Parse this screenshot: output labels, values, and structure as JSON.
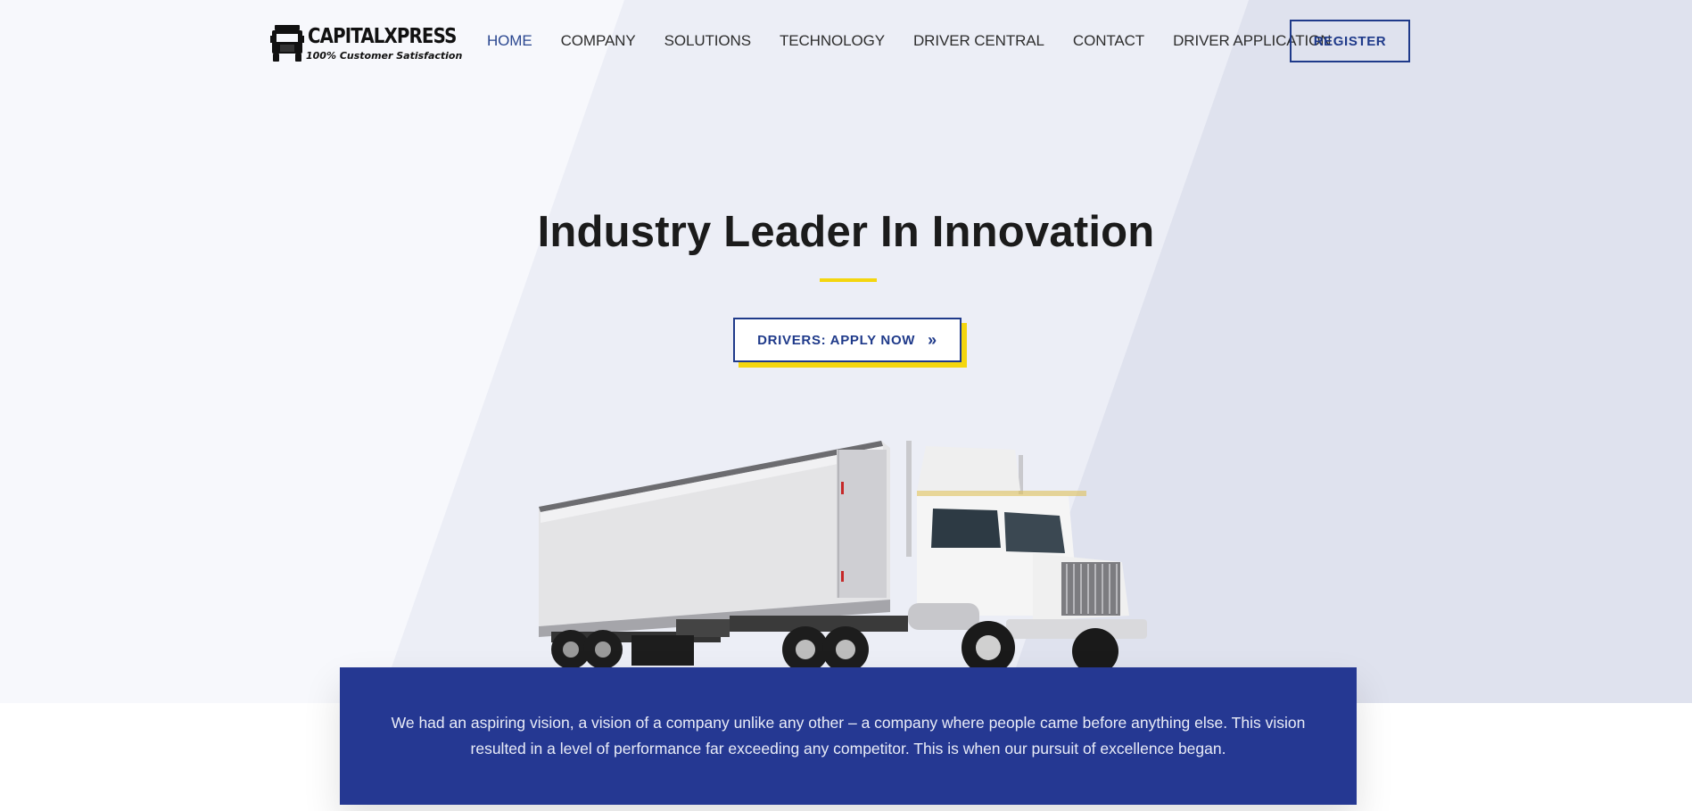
{
  "brand": {
    "name": "CAPITALXPRESS",
    "tagline": "100% Customer Satisfaction"
  },
  "nav": {
    "items": [
      {
        "label": "HOME",
        "active": true
      },
      {
        "label": "COMPANY",
        "active": false
      },
      {
        "label": "SOLUTIONS",
        "active": false
      },
      {
        "label": "TECHNOLOGY",
        "active": false
      },
      {
        "label": "DRIVER CENTRAL",
        "active": false
      },
      {
        "label": "CONTACT",
        "active": false
      },
      {
        "label": "DRIVER APPLICATION",
        "active": false
      }
    ],
    "register_label": "REGISTER"
  },
  "hero": {
    "headline": "Industry Leader In Innovation",
    "cta_label": "DRIVERS: APPLY NOW",
    "cta_icon": "double-chevron-right-icon"
  },
  "vision": {
    "text": "We had an aspiring vision, a vision of a company unlike any other – a company where people came before anything else. This vision resulted in a level of performance far exceeding any competitor. This is when our pursuit of excellence began."
  },
  "colors": {
    "primary": "#253892",
    "accent": "#f4d60e",
    "nav_active": "#2a4790",
    "text_dark": "#1b1b1b"
  }
}
